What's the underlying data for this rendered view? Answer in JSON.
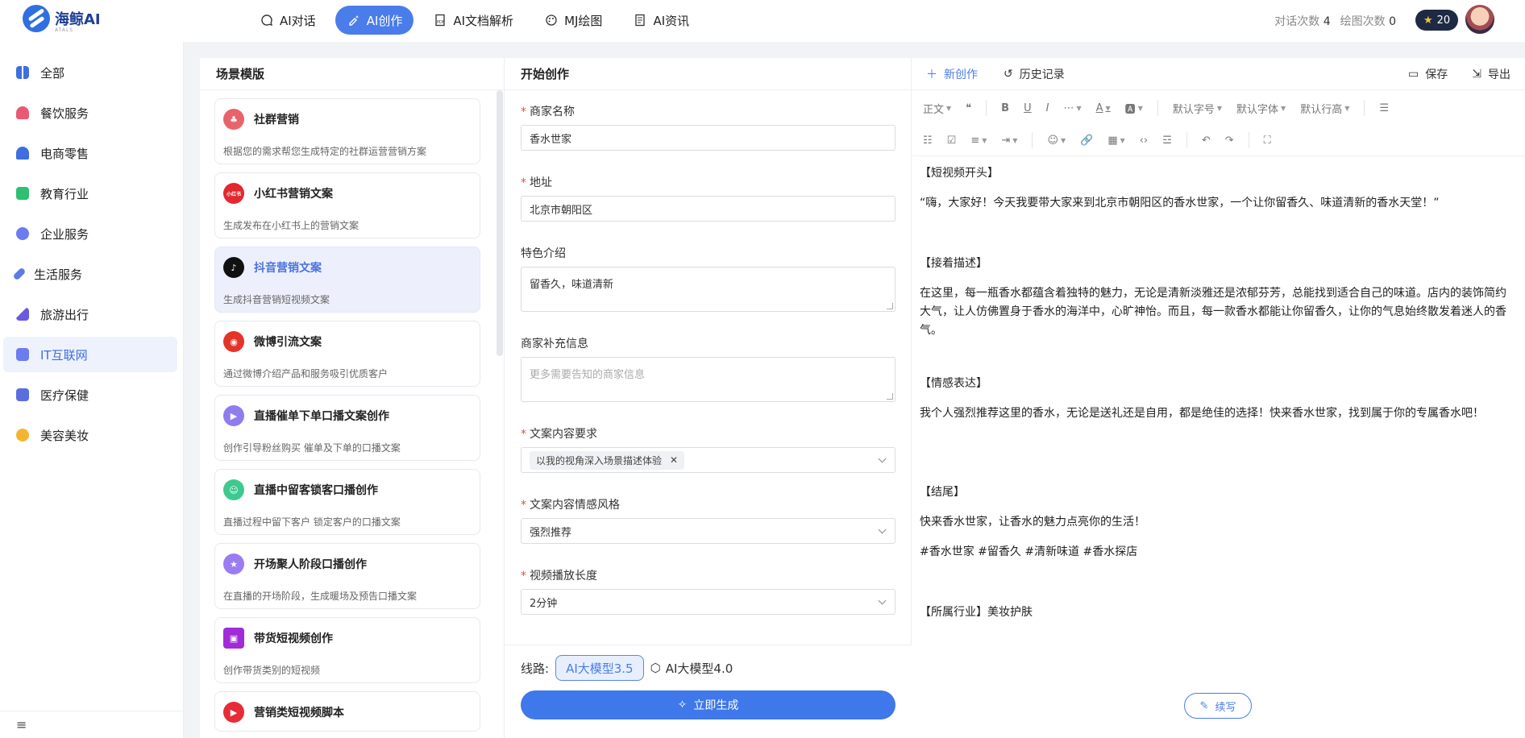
{
  "brand": {
    "name": "海鲸AI",
    "sub": "ATALS"
  },
  "nav": [
    {
      "label": "AI对话",
      "icon": "chat-icon"
    },
    {
      "label": "AI创作",
      "icon": "sparkle-icon",
      "active": true
    },
    {
      "label": "AI文档解析",
      "icon": "pdf-icon"
    },
    {
      "label": "MJ绘图",
      "icon": "palette-icon"
    },
    {
      "label": "AI资讯",
      "icon": "news-icon"
    }
  ],
  "stats": {
    "chat_label": "对话次数",
    "chat_count": "4",
    "draw_label": "绘图次数",
    "draw_count": "0"
  },
  "coins": "20",
  "sidebar": {
    "items": [
      {
        "label": "全部",
        "color": "#3e6ee0"
      },
      {
        "label": "餐饮服务",
        "color": "#e85a72"
      },
      {
        "label": "电商零售",
        "color": "#3e6ee0"
      },
      {
        "label": "教育行业",
        "color": "#2fbf71"
      },
      {
        "label": "企业服务",
        "color": "#6b7bf0"
      },
      {
        "label": "生活服务",
        "color": "#5b7be8"
      },
      {
        "label": "旅游出行",
        "color": "#6a5ae0"
      },
      {
        "label": "IT互联网",
        "color": "#6b7bf0",
        "active": true
      },
      {
        "label": "医疗保健",
        "color": "#5b6ee0"
      },
      {
        "label": "美容美妆",
        "color": "#f3b530"
      }
    ],
    "menu_icon": "≡"
  },
  "templates": {
    "title": "场景模版",
    "items": [
      {
        "title": "社群营销",
        "desc": "根据您的需求帮您生成特定的社群运营营销方案",
        "color": "#e8646a",
        "glyph": "♣"
      },
      {
        "title": "小红书营销文案",
        "desc": "生成发布在小红书上的营销文案",
        "color": "#e3282e",
        "glyph": "小红书"
      },
      {
        "title": "抖音营销文案",
        "desc": "生成抖音营销短视频文案",
        "color": "#111111",
        "glyph": "♪",
        "active": true
      },
      {
        "title": "微博引流文案",
        "desc": "通过微博介绍产品和服务吸引优质客户",
        "color": "#e6332a",
        "glyph": "◉"
      },
      {
        "title": "直播催单下单口播文案创作",
        "desc": "创作引导粉丝购买 催单及下单的口播文案",
        "color": "#8e7cf0",
        "glyph": "▶"
      },
      {
        "title": "直播中留客锁客口播创作",
        "desc": "直播过程中留下客户 锁定客户的口播文案",
        "color": "#3ec98f",
        "glyph": "☺"
      },
      {
        "title": "开场聚人阶段口播创作",
        "desc": "在直播的开场阶段，生成暖场及预告口播文案",
        "color": "#9b7cf3",
        "glyph": "★"
      },
      {
        "title": "带货短视频创作",
        "desc": "创作带货类别的短视频",
        "color": "#a12bd6",
        "glyph": "▣"
      },
      {
        "title": "营销类短视频脚本",
        "desc": "",
        "color": "#e62d36",
        "glyph": "▶"
      }
    ]
  },
  "form": {
    "title": "开始创作",
    "merchant": {
      "label": "商家名称",
      "value": "香水世家"
    },
    "address": {
      "label": "地址",
      "value": "北京市朝阳区"
    },
    "feature": {
      "label": "特色介绍",
      "value": "留香久，味道清新"
    },
    "extra": {
      "label": "商家补充信息",
      "placeholder": "更多需要告知的商家信息"
    },
    "requirement": {
      "label": "文案内容要求",
      "tag": "以我的视角深入场景描述体验"
    },
    "style": {
      "label": "文案内容情感风格",
      "value": "强烈推荐"
    },
    "duration": {
      "label": "视频播放长度",
      "value": "2分钟"
    },
    "route_label": "线路:",
    "model_a": "AI大模型3.5",
    "model_b": "AI大模型4.0",
    "generate": "立即生成"
  },
  "editor": {
    "new_label": "新创作",
    "history_label": "历史记录",
    "save_label": "保存",
    "export_label": "导出",
    "toolbar": {
      "paragraph": "正文",
      "font_size": "默认字号",
      "font_family": "默认字体",
      "line_height": "默认行高"
    },
    "content": [
      "【短视频开头】",
      "“嗨，大家好！今天我要带大家来到北京市朝阳区的香水世家，一个让你留香久、味道清新的香水天堂！”",
      "【接着描述】",
      "在这里，每一瓶香水都蕴含着独特的魅力，无论是清新淡雅还是浓郁芬芳，总能找到适合自己的味道。店内的装饰简约大气，让人仿佛置身于香水的海洋中，心旷神怡。而且，每一款香水都能让你留香久，让你的气息始终散发着迷人的香气。",
      "【情感表达】",
      "我个人强烈推荐这里的香水，无论是送礼还是自用，都是绝佳的选择！快来香水世家，找到属于你的专属香水吧！",
      "【结尾】",
      "快来香水世家，让香水的魅力点亮你的生活！",
      "#香水世家 #留香久 #清新味道 #香水探店",
      "【所属行业】美妆护肤"
    ],
    "continue_label": "续写"
  }
}
